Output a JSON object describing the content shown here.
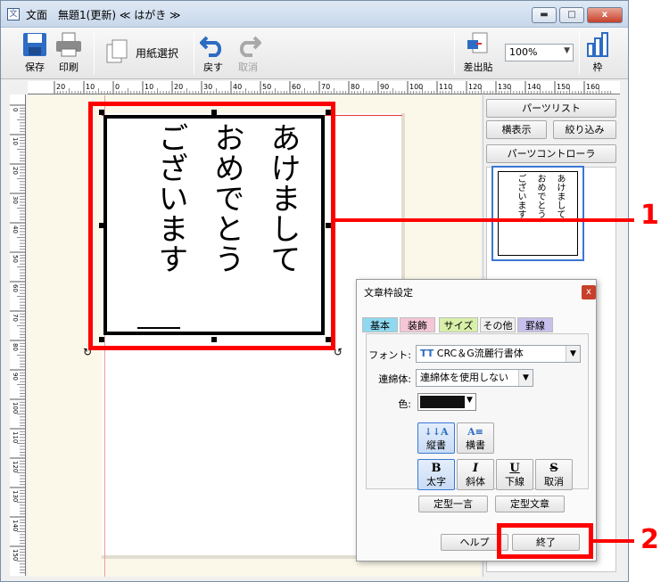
{
  "window": {
    "title": "文面　無題1(更新) ≪ はがき ≫",
    "app_icon_glyph": "文",
    "minimize_glyph": "▬",
    "maximize_glyph": "□",
    "close_glyph": "x"
  },
  "toolbar": {
    "save": "保存",
    "print": "印刷",
    "paper_select": "用紙選択",
    "undo": "戻す",
    "redo": "取消",
    "insert_field": "差出貼",
    "zoom": "100%",
    "frame": "枠"
  },
  "ruler": {
    "top_labels": [
      "20",
      "10",
      "0",
      "10",
      "20",
      "30",
      "40",
      "50",
      "60",
      "70",
      "80",
      "90",
      "100",
      "110",
      "120",
      "130",
      "140",
      "150",
      "160"
    ],
    "left_labels": [
      "0",
      "10",
      "20",
      "30",
      "40",
      "50",
      "60",
      "70",
      "80",
      "90",
      "100",
      "110",
      "120",
      "130",
      "140",
      "150"
    ]
  },
  "canvas": {
    "columns": [
      "あけまして",
      "おめでとう",
      "ございます"
    ]
  },
  "parts_panel": {
    "title": "パーツリスト",
    "horizontal_button": "横表示",
    "filter_button": "絞り込み",
    "controller_button": "パーツコントローラ",
    "thumbnail_columns": [
      "あけまして",
      "おめでとう",
      "ございます"
    ]
  },
  "dialog": {
    "title": "文章枠設定",
    "close": "x",
    "tabs": [
      {
        "label": "基本",
        "color": "#8fd9f0"
      },
      {
        "label": "装飾",
        "color": "#f5c6d6"
      },
      {
        "label": "サイズ",
        "color": "#d8f0a8"
      },
      {
        "label": "その他",
        "color": "#f0f0f0"
      },
      {
        "label": "罫線",
        "color": "#c8c0ec"
      }
    ],
    "font_label": "フォント:",
    "font_value": "CRC＆G流麗行書体",
    "font_icon": "TT",
    "ligature_label": "連綿体:",
    "ligature_value": "連綿体を使用しない",
    "color_label": "色:",
    "color_value": "#111111",
    "vertical_button": "縦書",
    "vertical_icon": "↓↓A",
    "horizontal_button": "横書",
    "horizontal_icon": "A≡",
    "bold": "太字",
    "bold_icon": "B",
    "italic": "斜体",
    "italic_icon": "I",
    "underline": "下線",
    "underline_icon": "U",
    "strike": "取消",
    "strike_icon": "S",
    "fixed_phrase": "定型一言",
    "fixed_text": "定型文章",
    "help": "ヘルプ",
    "finish": "終了"
  },
  "annotations": {
    "label_1": "1",
    "label_2": "2",
    "color": "#ff0000"
  }
}
